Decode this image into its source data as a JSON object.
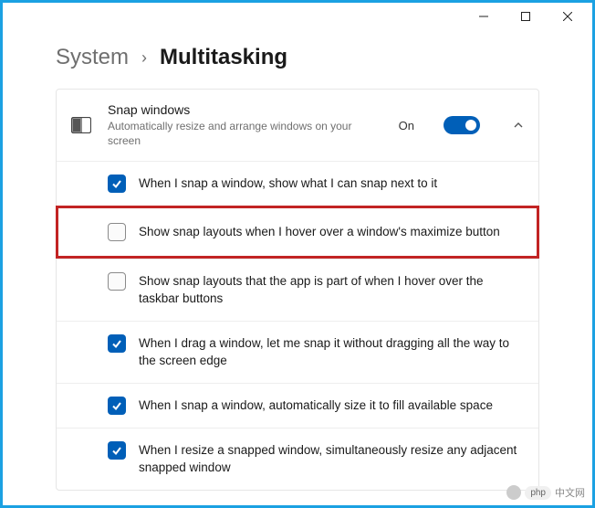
{
  "breadcrumb": {
    "parent": "System",
    "current": "Multitasking"
  },
  "header": {
    "title": "Snap windows",
    "description": "Automatically resize and arrange windows on your screen",
    "state_label": "On"
  },
  "options": [
    {
      "checked": true,
      "highlighted": false,
      "label": "When I snap a window, show what I can snap next to it"
    },
    {
      "checked": false,
      "highlighted": true,
      "label": "Show snap layouts when I hover over a window's maximize button"
    },
    {
      "checked": false,
      "highlighted": false,
      "label": "Show snap layouts that the app is part of when I hover over the taskbar buttons"
    },
    {
      "checked": true,
      "highlighted": false,
      "label": "When I drag a window, let me snap it without dragging all the way to the screen edge"
    },
    {
      "checked": true,
      "highlighted": false,
      "label": "When I snap a window, automatically size it to fill available space"
    },
    {
      "checked": true,
      "highlighted": false,
      "label": "When I resize a snapped window, simultaneously resize any adjacent snapped window"
    }
  ],
  "watermark": {
    "badge": "php",
    "text": "中文网"
  }
}
